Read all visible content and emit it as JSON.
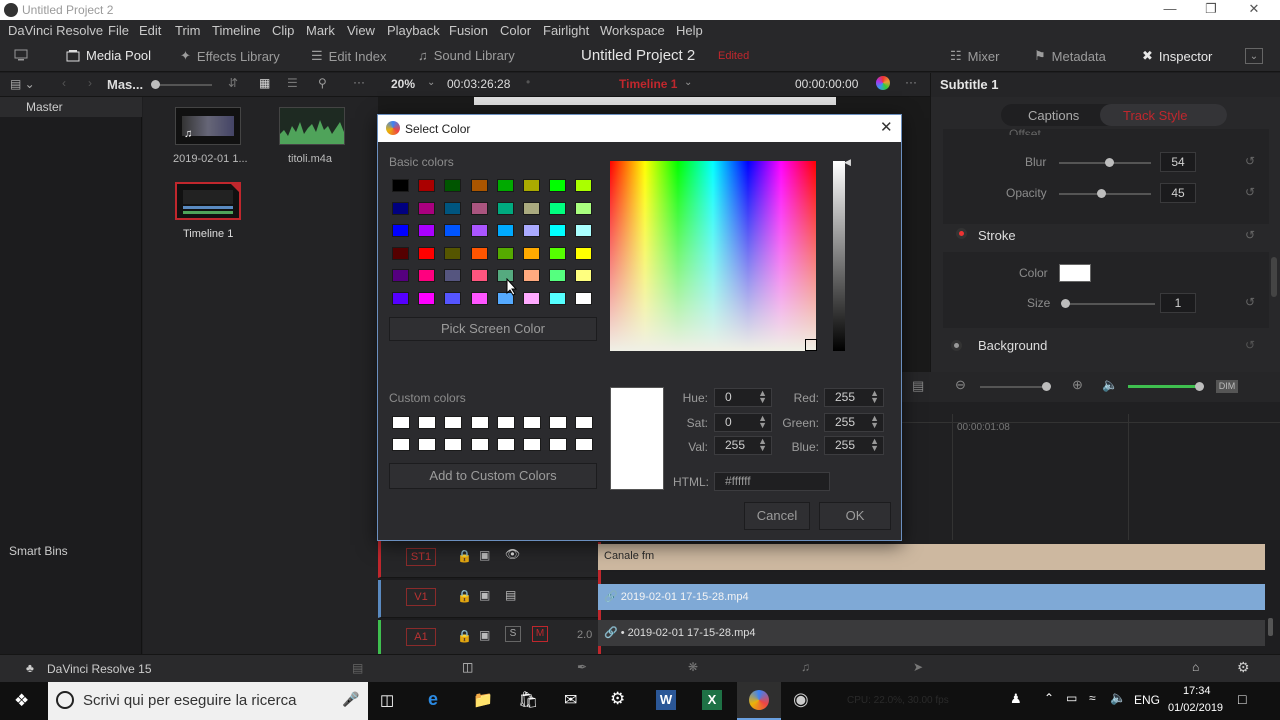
{
  "window": {
    "title": "Untitled Project 2"
  },
  "menu": [
    "DaVinci Resolve",
    "File",
    "Edit",
    "Trim",
    "Timeline",
    "Clip",
    "Mark",
    "View",
    "Playback",
    "Fusion",
    "Color",
    "Fairlight",
    "Workspace",
    "Help"
  ],
  "toolbar": {
    "media_pool": "Media Pool",
    "effects_library": "Effects Library",
    "edit_index": "Edit Index",
    "sound_library": "Sound Library",
    "project_title": "Untitled Project 2",
    "edited": "Edited",
    "mixer": "Mixer",
    "metadata": "Metadata",
    "inspector": "Inspector"
  },
  "bar2": {
    "bin_short": "Mas...",
    "zoom": "20%",
    "timecode_left": "00:03:26:28",
    "timeline_name": "Timeline 1",
    "timecode_right": "00:00:00:00",
    "panel_title": "Subtitle 1"
  },
  "bins": {
    "master": "Master",
    "smart_bins": "Smart Bins"
  },
  "pool_items": [
    {
      "label": "2019-02-01 1..."
    },
    {
      "label": "titoli.m4a"
    },
    {
      "label": "Timeline 1"
    }
  ],
  "inspector": {
    "tabs": [
      "Captions",
      "Track Style"
    ],
    "offset_label": "Offset",
    "blur_label": "Blur",
    "blur_value": "54",
    "opacity_label": "Opacity",
    "opacity_value": "45",
    "stroke_label": "Stroke",
    "color_label": "Color",
    "size_label": "Size",
    "size_value": "1",
    "background_label": "Background"
  },
  "timeline": {
    "ruler_tc": "00:00:01:08",
    "tracks": [
      {
        "label": "ST1",
        "clip": "Canale fm"
      },
      {
        "label": "V1",
        "clip": "2019-02-01 17-15-28.mp4"
      },
      {
        "label": "A1",
        "clip": "2019-02-01 17-15-28.mp4",
        "level": "2.0",
        "solo": "S",
        "mute": "M"
      }
    ]
  },
  "pagebar": {
    "app_name": "DaVinci Resolve 15"
  },
  "taskbar": {
    "search_placeholder": "Scrivi qui per eseguire la ricerca",
    "lang": "ENG",
    "time": "17:34",
    "date": "01/02/2019",
    "cpu_ghost": "CPU: 22.0%, 30.00 fps"
  },
  "dialog": {
    "title": "Select Color",
    "basic_colors_label": "Basic colors",
    "basic_colors": [
      [
        "#000000",
        "#aa0000",
        "#005500",
        "#aa5500",
        "#00aa00",
        "#aaaa00",
        "#00ff00",
        "#aaff00"
      ],
      [
        "#00007f",
        "#aa007f",
        "#00557f",
        "#aa557f",
        "#00aa7f",
        "#aaaa7f",
        "#00ff7f",
        "#aaff7f"
      ],
      [
        "#0000ff",
        "#aa00ff",
        "#0055ff",
        "#aa55ff",
        "#00aaff",
        "#aaaaff",
        "#00ffff",
        "#aaffff"
      ],
      [
        "#550000",
        "#ff0000",
        "#555500",
        "#ff5500",
        "#55aa00",
        "#ffaa00",
        "#55ff00",
        "#ffff00"
      ],
      [
        "#55007f",
        "#ff007f",
        "#55557f",
        "#ff557f",
        "#55aa7f",
        "#ffaa7f",
        "#55ff7f",
        "#ffff7f"
      ],
      [
        "#5500ff",
        "#ff00ff",
        "#5555ff",
        "#ff55ff",
        "#55aaff",
        "#ffaaff",
        "#55ffff",
        "#ffffff"
      ]
    ],
    "pick_screen": "Pick Screen Color",
    "custom_colors_label": "Custom colors",
    "add_custom": "Add to Custom Colors",
    "hue_label": "Hue:",
    "hue": "0",
    "sat_label": "Sat:",
    "sat": "0",
    "val_label": "Val:",
    "val": "255",
    "red_label": "Red:",
    "red": "255",
    "green_label": "Green:",
    "green": "255",
    "blue_label": "Blue:",
    "blue": "255",
    "html_label": "HTML:",
    "html": "#ffffff",
    "cancel": "Cancel",
    "ok": "OK",
    "current_color": "#ffffff"
  },
  "colors": {
    "accent_red": "#c0272d",
    "clip_subtitle": "#cdb8a0",
    "clip_video": "#7fa9d6",
    "dialog_border": "#6b8fbf"
  }
}
